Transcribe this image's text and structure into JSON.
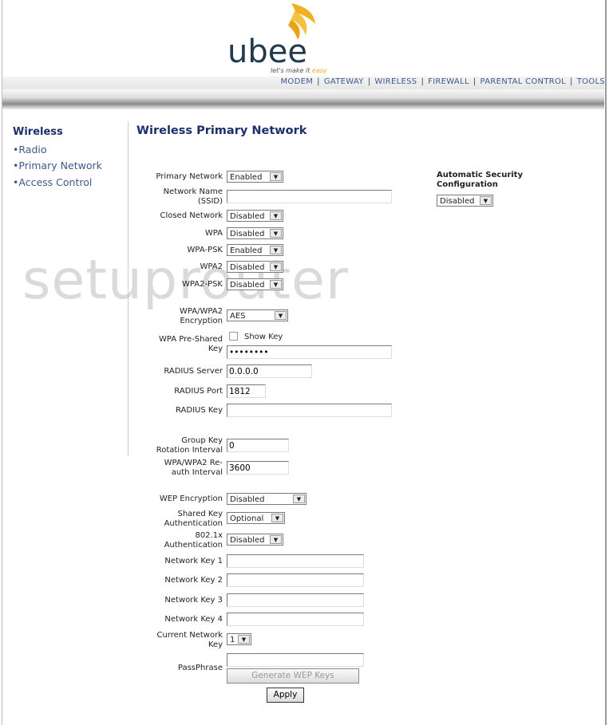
{
  "brand": {
    "name": "ubee",
    "tagline_pre": "let's make it ",
    "tagline_em": "easy",
    "accent": "#f2b122",
    "logo_color": "#1f3b4d"
  },
  "nav": [
    "MODEM",
    "GATEWAY",
    "WIRELESS",
    "FIREWALL",
    "PARENTAL CONTROL",
    "TOOLS"
  ],
  "sidebar": {
    "title": "Wireless",
    "items": [
      "Radio",
      "Primary Network",
      "Access Control"
    ]
  },
  "page": {
    "title": "Wireless Primary Network"
  },
  "form": {
    "primary_network": {
      "label": "Primary Network",
      "value": "Enabled"
    },
    "ssid": {
      "label1": "Network Name",
      "label2": "(SSID)",
      "value": ""
    },
    "closed_network": {
      "label": "Closed Network",
      "value": "Disabled"
    },
    "wpa": {
      "label": "WPA",
      "value": "Disabled"
    },
    "wpa_psk": {
      "label": "WPA-PSK",
      "value": "Enabled"
    },
    "wpa2": {
      "label": "WPA2",
      "value": "Disabled"
    },
    "wpa2_psk": {
      "label": "WPA2-PSK",
      "value": "Disabled"
    },
    "encryption": {
      "label1": "WPA/WPA2",
      "label2": "Encryption",
      "value": "AES"
    },
    "psk": {
      "label1": "WPA Pre-Shared",
      "label2": "Key",
      "show_key": "Show Key",
      "value": "••••••••"
    },
    "radius_server": {
      "label": "RADIUS Server",
      "value": "0.0.0.0"
    },
    "radius_port": {
      "label": "RADIUS Port",
      "value": "1812"
    },
    "radius_key": {
      "label": "RADIUS Key",
      "value": ""
    },
    "group_key": {
      "label1": "Group Key",
      "label2": "Rotation Interval",
      "value": "0"
    },
    "reauth": {
      "label1": "WPA/WPA2 Re-",
      "label2": "auth Interval",
      "value": "3600"
    },
    "wep_encryption": {
      "label": "WEP Encryption",
      "value": "Disabled"
    },
    "shared_key_auth": {
      "label1": "Shared Key",
      "label2": "Authentication",
      "value": "Optional"
    },
    "dot1x_auth": {
      "label1": "802.1x",
      "label2": "Authentication",
      "value": "Disabled"
    },
    "network_keys": [
      {
        "label": "Network Key 1",
        "value": ""
      },
      {
        "label": "Network Key 2",
        "value": ""
      },
      {
        "label": "Network Key 3",
        "value": ""
      },
      {
        "label": "Network Key 4",
        "value": ""
      }
    ],
    "current_key": {
      "label1": "Current Network",
      "label2": "Key",
      "value": "1"
    },
    "passphrase": {
      "label": "PassPhrase",
      "value": ""
    },
    "generate_label": "Generate WEP Keys",
    "apply_label": "Apply"
  },
  "auto_security": {
    "label1": "Automatic Security",
    "label2": "Configuration",
    "value": "Disabled"
  },
  "watermark": "setuprouter"
}
